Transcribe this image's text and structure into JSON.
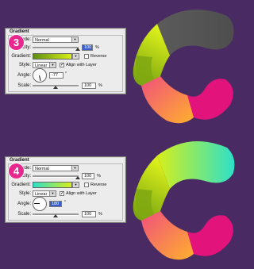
{
  "panels": [
    {
      "title": "Gradient",
      "step": "3",
      "mode_label": "Mode:",
      "mode_value": "Normal",
      "opacity_label": "Opacity:",
      "opacity_value": "100",
      "opacity_unit": "%",
      "gradient_label": "Gradient:",
      "reverse_label": "Reverse",
      "style_label": "Style:",
      "style_value": "Linear",
      "align_label": "Align with Layer",
      "angle_label": "Angle:",
      "angle_value": "-77",
      "angle_unit": "°",
      "scale_label": "Scale:",
      "scale_value": "100",
      "scale_unit": "%",
      "gradient_colors": [
        "#5f8e12",
        "#d8ef17"
      ],
      "angle_deg": -77
    },
    {
      "title": "Gradient",
      "step": "4",
      "mode_label": "Mode:",
      "mode_value": "Normal",
      "opacity_label": "Opacity:",
      "opacity_value": "100",
      "opacity_unit": "%",
      "gradient_label": "Gradient:",
      "reverse_label": "Reverse",
      "style_label": "Style:",
      "style_value": "Linear",
      "align_label": "Align with Layer",
      "angle_label": "Angle:",
      "angle_value": "180",
      "angle_unit": "°",
      "scale_label": "Scale:",
      "scale_value": "100",
      "scale_unit": "%",
      "gradient_colors": [
        "#2de0c8",
        "#d7ef1a"
      ],
      "angle_deg": 180
    }
  ],
  "colors": {
    "background": "#4a2a62",
    "badge": "#e8288e",
    "segment_gray": "#5a5a5a",
    "segment_pink": "#e0157a",
    "segment_orange": "#ff8f35",
    "segment_yellow_green": "#cbe418",
    "segment_green": "#7fae12"
  }
}
